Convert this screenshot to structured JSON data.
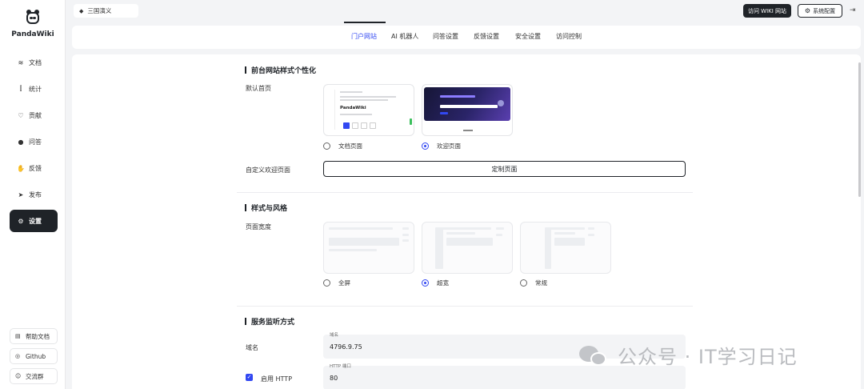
{
  "brand": {
    "name": "PandaWiki"
  },
  "sidebar": {
    "items": [
      {
        "icon": "≋",
        "label": "文档"
      },
      {
        "icon": "⫿",
        "label": "统计"
      },
      {
        "icon": "♡",
        "label": "贡献"
      },
      {
        "icon": "●",
        "label": "问答"
      },
      {
        "icon": "✋",
        "label": "反馈"
      },
      {
        "icon": "➤",
        "label": "发布"
      },
      {
        "icon": "⚙",
        "label": "设置"
      }
    ],
    "bottom": [
      {
        "icon": "▤",
        "label": "帮助文档"
      },
      {
        "icon": "◎",
        "label": "Github"
      },
      {
        "icon": "☺",
        "label": "交流群"
      }
    ]
  },
  "header": {
    "kb_name": "三国演义",
    "visit_label": "访问 WIKI 网站",
    "settings_label": "系统配置"
  },
  "tabs": [
    "门户网站",
    "AI 机器人",
    "问答设置",
    "反馈设置",
    "安全设置",
    "访问控制"
  ],
  "active_tab": "门户网站",
  "portal": {
    "title": "前台网站样式个性化",
    "home_label": "默认首页",
    "home_options": [
      "文档页面",
      "欢迎页面"
    ],
    "home_selected": "欢迎页面",
    "thumb_brand": "PandaWiki",
    "custom_label": "自定义欢迎页面",
    "custom_button": "定制页面"
  },
  "style": {
    "title": "样式与风格",
    "width_label": "页面宽度",
    "width_options": [
      "全屏",
      "超宽",
      "常规"
    ],
    "width_selected": "超宽"
  },
  "service": {
    "title": "服务监听方式",
    "domain_label": "域名",
    "domain_field_label": "域名",
    "domain_value": "4796.9.75",
    "http_label": "启用 HTTP",
    "http_enabled": true,
    "http_port_label": "HTTP 端口",
    "http_port_value": "80"
  },
  "watermark": {
    "text": "公众号 · IT学习日记"
  },
  "colors": {
    "accent": "#3248f2",
    "dark": "#1f2328"
  }
}
